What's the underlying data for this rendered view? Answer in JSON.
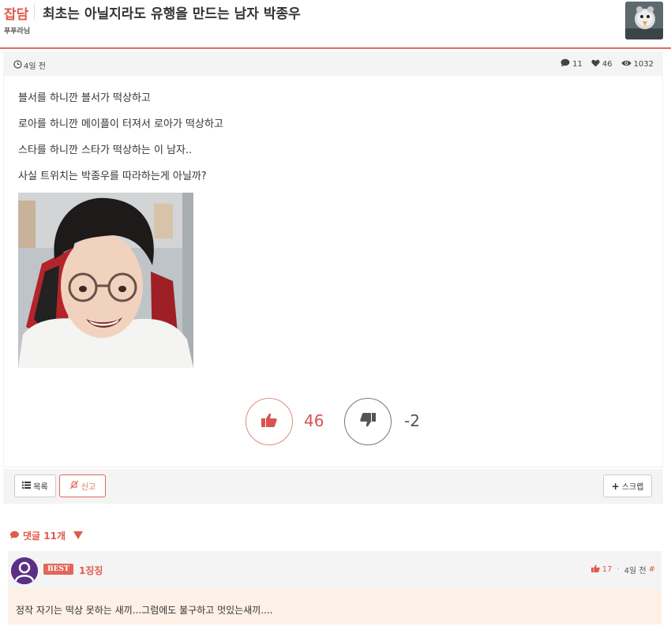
{
  "post": {
    "category": "잡담",
    "title": "최초는 아닐지라도 유행을 만드는 남자 박종우",
    "author": "푸푸라님",
    "time": "4일 전",
    "stats": {
      "comments": "11",
      "likes": "46",
      "views": "1032"
    },
    "lines": [
      "블서를 하니깐 블서가 떡상하고",
      "로아를 하니깐 메이플이 터져서 로아가 떡상하고",
      "스타를 하니깐 스타가 떡상하는 이 남자..",
      "사실 트위치는 박종우를 따라하는게 아닐까?"
    ]
  },
  "vote": {
    "up": "46",
    "down": "-2"
  },
  "actions": {
    "list": "목록",
    "report": "신고",
    "scrap": "스크랩"
  },
  "comments": {
    "header": "댓글 11개",
    "best": {
      "badge": "BEST",
      "author": "1징징",
      "likes": "17",
      "time": "4일 전",
      "hash": "#",
      "text": "정작 자기는 떡상 못하는 새끼...그럼에도 불구하고 멋있는새끼...."
    }
  },
  "colors": {
    "accent": "#e05b4b",
    "meta_bg": "#f4f4f4",
    "comment_bg": "#fdf0e6"
  },
  "icons": [
    "clock-icon",
    "comment-icon",
    "heart-icon",
    "eye-icon",
    "thumbs-up-icon",
    "thumbs-down-icon",
    "list-icon",
    "report-icon",
    "plus-icon",
    "dropdown-arrow-icon",
    "user-avatar-icon"
  ]
}
